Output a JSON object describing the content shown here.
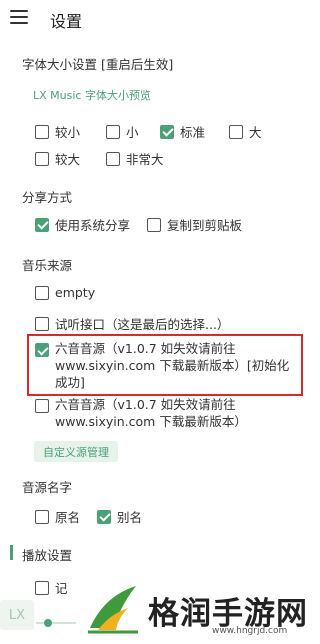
{
  "header": {
    "title": "设置"
  },
  "font_size": {
    "heading": "字体大小设置 [重启后生效]",
    "preview": "LX Music 字体大小预览",
    "options": [
      {
        "label": "较小",
        "checked": false
      },
      {
        "label": "小",
        "checked": false
      },
      {
        "label": "标准",
        "checked": true
      },
      {
        "label": "大",
        "checked": false
      },
      {
        "label": "较大",
        "checked": false
      },
      {
        "label": "非常大",
        "checked": false
      }
    ]
  },
  "share": {
    "heading": "分享方式",
    "options": [
      {
        "label": "使用系统分享",
        "checked": true
      },
      {
        "label": "复制到剪贴板",
        "checked": false
      }
    ]
  },
  "music_source": {
    "heading": "音乐来源",
    "options": [
      {
        "label": "empty",
        "checked": false
      },
      {
        "label": "试听接口（这是最后的选择...）",
        "checked": false
      },
      {
        "label": "六音音源（v1.0.7 如失效请前往 www.sixyin.com 下载最新版本）[初始化成功]",
        "checked": true
      },
      {
        "label": "六音音源（v1.0.7 如失效请前往 www.sixyin.com 下载最新版本）",
        "checked": false
      }
    ],
    "custom_button": "自定义源管理"
  },
  "source_name": {
    "heading": "音源名字",
    "options": [
      {
        "label": "原名",
        "checked": false
      },
      {
        "label": "别名",
        "checked": true
      }
    ]
  },
  "playback": {
    "heading": "播放设置",
    "first_option_partial": "记"
  },
  "player": {
    "logo_text": "LX"
  },
  "watermark": {
    "title": "格润手游网",
    "url": "www.hngrjd.com"
  },
  "colors": {
    "accent": "#4ba177",
    "highlight_border": "#d62b2b"
  }
}
